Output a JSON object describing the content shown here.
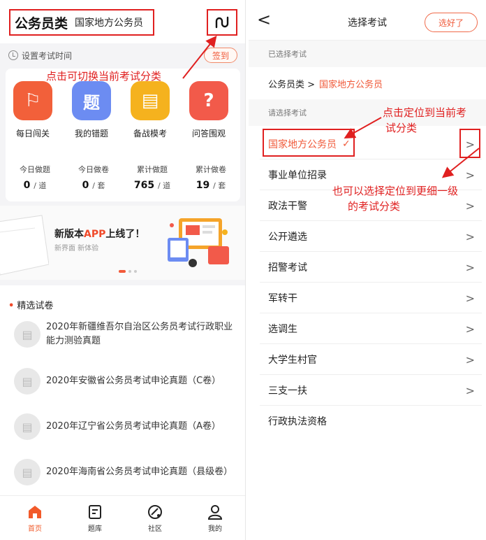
{
  "left": {
    "category_main": "公务员类",
    "category_sub": "国家地方公务员",
    "set_exam_time": "设置考试时间",
    "signin_label": "签到",
    "features": [
      {
        "label": "每日闯关",
        "icon": "ribbon-icon",
        "color": "#f2603a"
      },
      {
        "label": "我的错题",
        "icon": "question-icon",
        "color": "#6c8cf2"
      },
      {
        "label": "备战模考",
        "icon": "exam-icon",
        "color": "#f5b21e"
      },
      {
        "label": "问答围观",
        "icon": "chat-icon",
        "color": "#f25a4a"
      }
    ],
    "feature_glyphs": [
      "⚐",
      "题",
      "▤",
      "?"
    ],
    "stats": [
      {
        "title": "今日做题",
        "value": "0",
        "unit": "/ 道"
      },
      {
        "title": "今日做卷",
        "value": "0",
        "unit": "/ 套"
      },
      {
        "title": "累计做题",
        "value": "765",
        "unit": "/ 道"
      },
      {
        "title": "累计做卷",
        "value": "19",
        "unit": "/ 套"
      }
    ],
    "banner": {
      "title_prefix": "新版本",
      "title_highlight": "APP",
      "title_suffix": "上线了！",
      "subtitle": "新界面  新体验"
    },
    "papers_title": "精选试卷",
    "papers": [
      {
        "line1": "2020年新疆维吾尔自治区公务员考试行政职业",
        "line2": "能力测验真题"
      },
      {
        "line1": "2020年安徽省公务员考试申论真题（C卷）",
        "line2": ""
      },
      {
        "line1": "2020年辽宁省公务员考试申论真题（A卷）",
        "line2": ""
      },
      {
        "line1": "2020年海南省公务员考试申论真题（县级卷）",
        "line2": ""
      }
    ],
    "tabs": [
      {
        "label": "首页",
        "icon": "home-icon",
        "active": true
      },
      {
        "label": "题库",
        "icon": "question-bank-icon",
        "active": false
      },
      {
        "label": "社区",
        "icon": "community-icon",
        "active": false
      },
      {
        "label": "我的",
        "icon": "profile-icon",
        "active": false
      }
    ]
  },
  "right": {
    "title": "选择考试",
    "done_label": "选好了",
    "back_symbol": "<",
    "selected_section": "已选择考试",
    "selected_parent": "公务员类 >",
    "selected_child": "国家地方公务员",
    "choose_section": "请选择考试",
    "items": [
      {
        "label": "国家地方公务员",
        "check": "✓",
        "current": true
      },
      {
        "label": "事业单位招录"
      },
      {
        "label": "政法干警"
      },
      {
        "label": "公开遴选"
      },
      {
        "label": "招警考试"
      },
      {
        "label": "军转干"
      },
      {
        "label": "选调生"
      },
      {
        "label": "大学生村官"
      },
      {
        "label": "三支一扶"
      },
      {
        "label": "行政执法资格"
      }
    ],
    "chevron": ">"
  },
  "annotations": {
    "switch_hint": "点击可切换当前考试分类",
    "locate_hint_1": "点击定位到当前考",
    "locate_hint_2": "试分类",
    "detail_hint_1": "也可以选择定位到更细一级",
    "detail_hint_2": "的考试分类"
  },
  "colors": {
    "accent": "#f05a3a",
    "annotation": "#e02020"
  }
}
